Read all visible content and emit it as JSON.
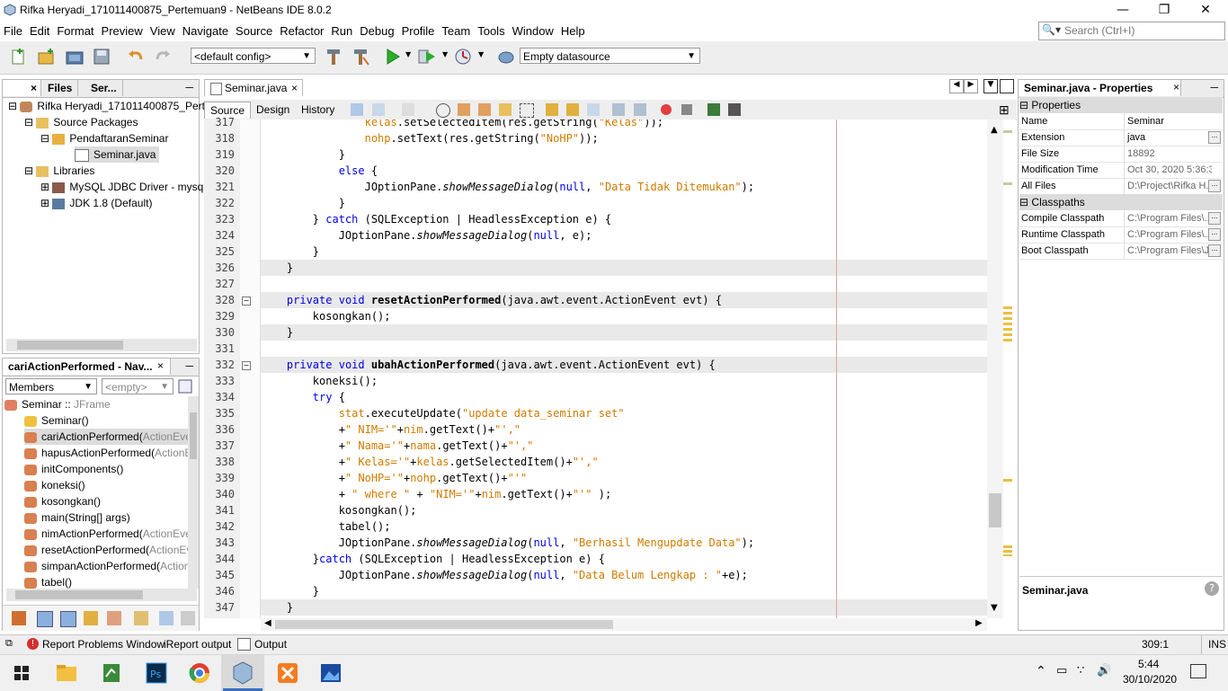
{
  "window": {
    "title": "Rifka Heryadi_171011400875_Pertemuan9 - NetBeans IDE 8.0.2"
  },
  "menu": [
    "File",
    "Edit",
    "Format",
    "Preview",
    "View",
    "Navigate",
    "Source",
    "Refactor",
    "Run",
    "Debug",
    "Profile",
    "Team",
    "Tools",
    "Window",
    "Help"
  ],
  "search": {
    "placeholder": "Search (Ctrl+I)"
  },
  "toolbar": {
    "config": "<default config>",
    "datasource": "Empty datasource"
  },
  "projects": {
    "tabs": [
      "Files",
      "Ser..."
    ],
    "tree": [
      {
        "label": "Rifka Heryadi_171011400875_Perte"
      },
      {
        "label": "Source Packages"
      },
      {
        "label": "PendaftaranSeminar"
      },
      {
        "label": "Seminar.java"
      },
      {
        "label": "Libraries"
      },
      {
        "label": "MySQL JDBC Driver - mysql-c"
      },
      {
        "label": "JDK 1.8 (Default)"
      }
    ]
  },
  "navigator": {
    "title": "cariActionPerformed - Nav...",
    "members_label": "Members",
    "filter": "<empty>",
    "items": [
      {
        "name": "Seminar :: ",
        "type": "JFrame"
      },
      {
        "name": "Seminar()",
        "type": ""
      },
      {
        "name": "cariActionPerformed(",
        "type": "ActionEvent"
      },
      {
        "name": "hapusActionPerformed(",
        "type": "ActionEv"
      },
      {
        "name": "initComponents()",
        "type": ""
      },
      {
        "name": "koneksi()",
        "type": ""
      },
      {
        "name": "kosongkan()",
        "type": ""
      },
      {
        "name": "main(String[] args)",
        "type": ""
      },
      {
        "name": "nimActionPerformed(",
        "type": "ActionEvent"
      },
      {
        "name": "resetActionPerformed(",
        "type": "ActionEve"
      },
      {
        "name": "simpanActionPerformed(",
        "type": "ActionEv"
      },
      {
        "name": "tabel()",
        "type": ""
      }
    ]
  },
  "editor": {
    "tab": "Seminar.java",
    "views": [
      "Source",
      "Design",
      "History"
    ],
    "line_numbers": [
      "317",
      "318",
      "319",
      "320",
      "321",
      "322",
      "323",
      "324",
      "325",
      "326",
      "327",
      "328",
      "329",
      "330",
      "331",
      "332",
      "333",
      "334",
      "335",
      "336",
      "337",
      "338",
      "339",
      "340",
      "341",
      "342",
      "343",
      "344",
      "345",
      "346",
      "347"
    ]
  },
  "properties": {
    "title": "Seminar.java - Properties",
    "section_properties": "Properties",
    "section_classpaths": "Classpaths",
    "rows": [
      {
        "key": "Name",
        "value": "Seminar"
      },
      {
        "key": "Extension",
        "value": "java"
      },
      {
        "key": "File Size",
        "value": "18892"
      },
      {
        "key": "Modification Time",
        "value": "Oct 30, 2020 5:36:31 ..."
      },
      {
        "key": "All Files",
        "value": "D:\\Project\\Rifka H..."
      }
    ],
    "classpaths": [
      {
        "key": "Compile Classpath",
        "value": "C:\\Program Files\\..."
      },
      {
        "key": "Runtime Classpath",
        "value": "C:\\Program Files\\..."
      },
      {
        "key": "Boot Classpath",
        "value": "C:\\Program Files\\J..."
      }
    ],
    "footer": "Seminar.java"
  },
  "status": {
    "report_problems": "Report Problems Window",
    "ireport": "iReport output",
    "output": "Output",
    "position": "309:1",
    "mode": "INS"
  },
  "taskbar": {
    "time": "5:44",
    "date": "30/10/2020"
  },
  "colors": {
    "keyword": "#0000e6",
    "string": "#ce7b00",
    "margin": "#e8a0a0"
  }
}
